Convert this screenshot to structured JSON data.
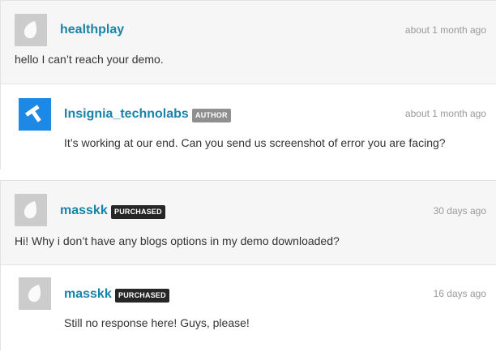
{
  "threads": [
    {
      "comment": {
        "username": "healthplay",
        "badge": "",
        "time": "about 1 month ago",
        "text": "hello I can’t reach your demo.",
        "avatar": "default-avatar-icon"
      },
      "reply": {
        "username": "Insignia_technolabs",
        "badge": "AUTHOR",
        "time": "about 1 month ago",
        "text": "It’s working at our end. Can you send us screenshot of error you are facing?",
        "avatar": "insignia-logo-icon"
      }
    },
    {
      "comment": {
        "username": "masskk",
        "badge": "PURCHASED",
        "time": "30 days ago",
        "text": "Hi! Why i don’t have any blogs options in my demo downloaded?",
        "avatar": "default-avatar-icon"
      },
      "reply": {
        "username": "masskk",
        "badge": "PURCHASED",
        "time": "16 days ago",
        "text": "Still no response here! Guys, please!",
        "avatar": "default-avatar-icon"
      }
    }
  ],
  "colors": {
    "username": "#1a83a8",
    "author_badge": "#8f8f8f",
    "purchased_badge": "#262626",
    "brand_avatar": "#1e88e5"
  }
}
